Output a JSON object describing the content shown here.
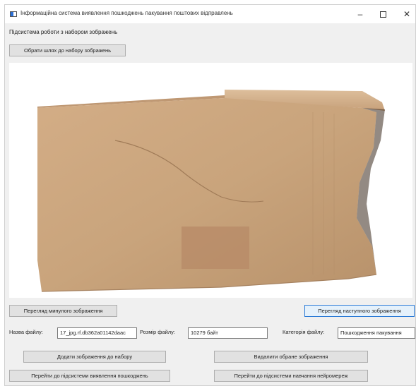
{
  "window": {
    "title": "Інформаційна система виявлення пошкоджень пакування поштових відправлень",
    "minimize_glyph": "–",
    "close_glyph": "✕"
  },
  "subsystem_label": "Підсистема роботи з набором зображень",
  "buttons": {
    "select_path": "Обрати шлях до набору зображень",
    "prev_image": "Перегляд минулого зображення",
    "next_image": "Перегляд наступного зображення",
    "add_image": "Додати зображення до набору",
    "delete_image": "Видалити обране зображення",
    "go_detection": "Перейти до підсистеми виявлення пошкоджень",
    "go_training": "Перейти до підсистеми навчання нейромереж"
  },
  "fields": {
    "name_label": "Назва файлу:",
    "name_value": "17_jpg.rf.db362a01142daac",
    "size_label": "Розмір файлу:",
    "size_value": "10279 байт",
    "category_label": "Категорія файлу:",
    "category_value": "Пошкодження пакування"
  },
  "image": {
    "subject": "damaged cardboard box",
    "colors": {
      "cardboard": "#c9a47c",
      "cardboard_dark": "#b58d66",
      "tape": "#b88c68"
    }
  }
}
